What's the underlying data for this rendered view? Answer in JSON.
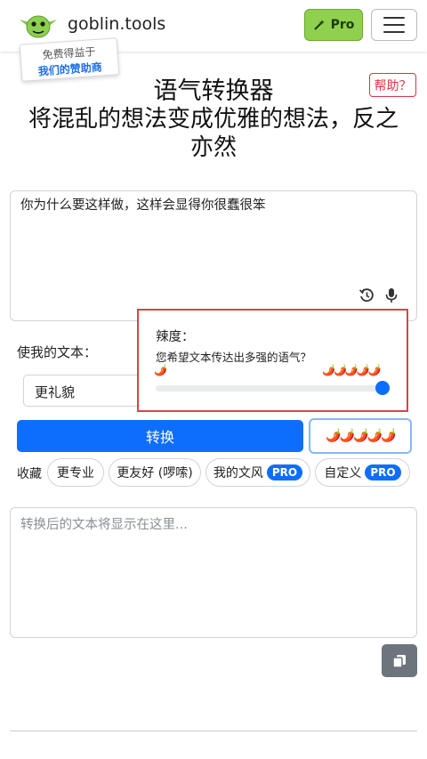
{
  "header": {
    "brand": "goblin.tools",
    "pro_label": "Pro",
    "sponsor_line1": "免费得益于",
    "sponsor_line2": "我们的赞助商"
  },
  "help_label": "帮助？",
  "page_title": "语气转换器",
  "page_subtitle": "将混乱的想法变成优雅的想法，反之亦然",
  "input": {
    "value": "你为什么要这样做，这样会显得你很蠢很笨"
  },
  "controls": {
    "make_text_label": "使我的文本：",
    "tone_selected": "更礼貌",
    "convert_label": "转换",
    "spice_button": "🌶️🌶️🌶️🌶️🌶️"
  },
  "spice_popover": {
    "title": "辣度：",
    "question": "您希望文本传达出多强的语气？",
    "min_label": "🌶️",
    "max_label": "🌶️🌶️🌶️🌶️🌶️",
    "level_fraction": 1.0
  },
  "favorites": {
    "label": "收藏",
    "chips": [
      {
        "label": "更专业"
      },
      {
        "label": "更友好 (啰嗦)"
      },
      {
        "label": "我的文风",
        "badge": "PRO"
      },
      {
        "label": "自定义",
        "badge": "PRO"
      }
    ]
  },
  "output": {
    "placeholder": "转换后的文本将显示在这里..."
  },
  "colors": {
    "primary": "#0d6efd",
    "pro_green": "#8fd14f",
    "help_red": "#dc3545",
    "highlight_red": "#d9444a"
  }
}
